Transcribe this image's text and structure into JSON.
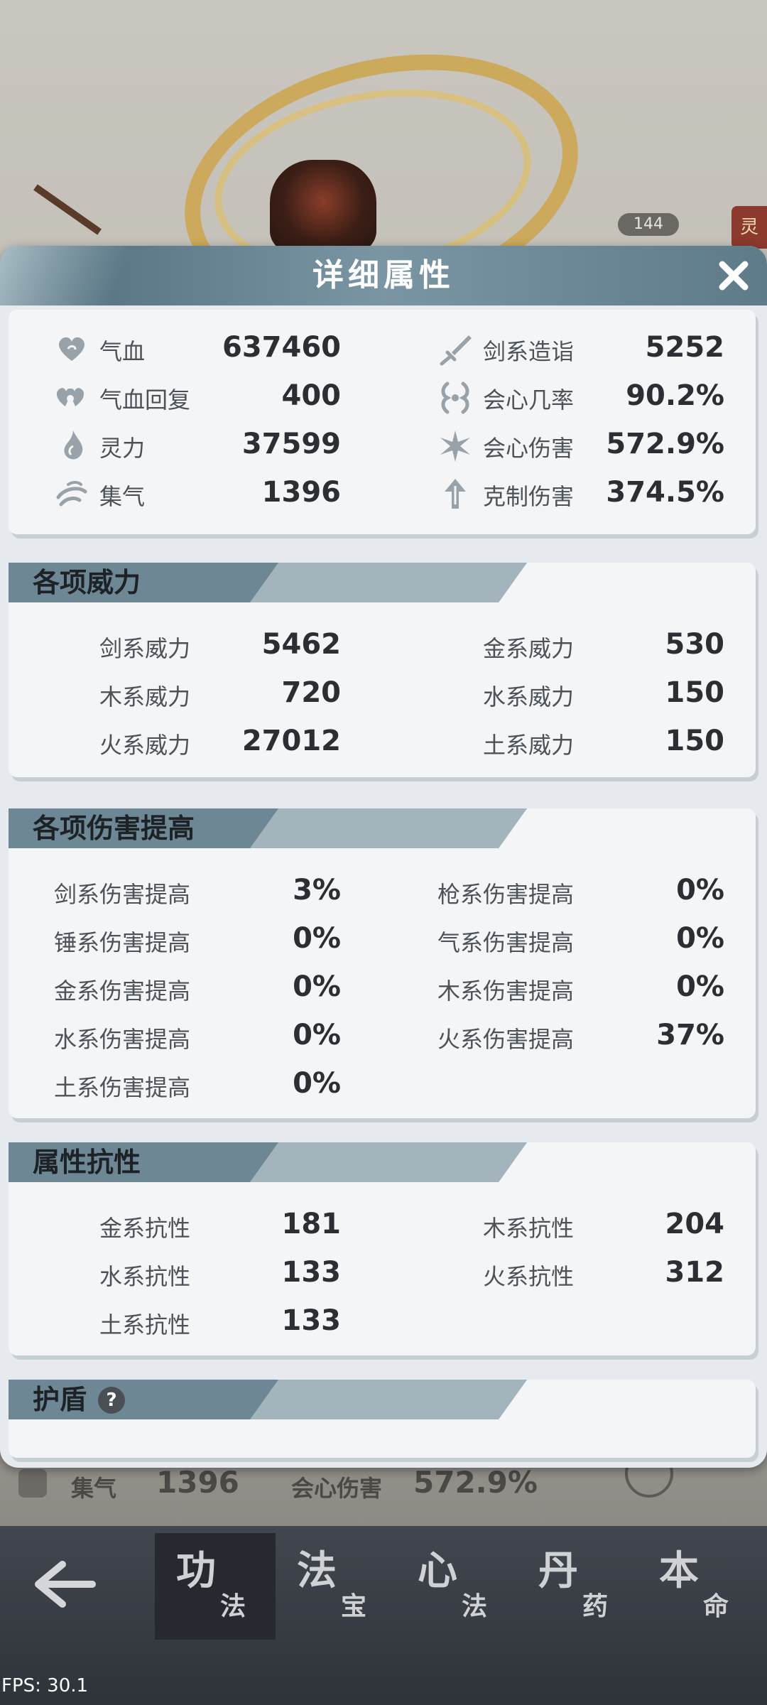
{
  "background": {
    "level_badge": "144",
    "side_tag": "灵",
    "under_row": {
      "stat_a_label": "集气",
      "stat_a_value": "1396",
      "stat_b_label": "会心伤害",
      "stat_b_value": "572.9%"
    }
  },
  "modal": {
    "title": "详细属性",
    "close_icon": "close-icon"
  },
  "basic_stats": {
    "left": [
      {
        "icon": "heart-icon",
        "label": "气血",
        "value": "637460"
      },
      {
        "icon": "double-heart-icon",
        "label": "气血回复",
        "value": "400"
      },
      {
        "icon": "flame-drop-icon",
        "label": "灵力",
        "value": "37599"
      },
      {
        "icon": "swirl-icon",
        "label": "集气",
        "value": "1396"
      }
    ],
    "right": [
      {
        "icon": "sword-icon",
        "label": "剑系造诣",
        "value": "5252"
      },
      {
        "icon": "crit-rate-icon",
        "label": "会心几率",
        "value": "90.2%"
      },
      {
        "icon": "starburst-icon",
        "label": "会心伤害",
        "value": "572.9%"
      },
      {
        "icon": "arrow-up-icon",
        "label": "克制伤害",
        "value": "374.5%"
      }
    ]
  },
  "power_section": {
    "title": "各项威力",
    "left": [
      {
        "label": "剑系威力",
        "value": "5462"
      },
      {
        "label": "木系威力",
        "value": "720"
      },
      {
        "label": "火系威力",
        "value": "27012"
      }
    ],
    "right": [
      {
        "label": "金系威力",
        "value": "530"
      },
      {
        "label": "水系威力",
        "value": "150"
      },
      {
        "label": "土系威力",
        "value": "150"
      }
    ]
  },
  "damage_section": {
    "title": "各项伤害提高",
    "left": [
      {
        "label": "剑系伤害提高",
        "value": "3%"
      },
      {
        "label": "锤系伤害提高",
        "value": "0%"
      },
      {
        "label": "金系伤害提高",
        "value": "0%"
      },
      {
        "label": "水系伤害提高",
        "value": "0%"
      },
      {
        "label": "土系伤害提高",
        "value": "0%"
      }
    ],
    "right": [
      {
        "label": "枪系伤害提高",
        "value": "0%"
      },
      {
        "label": "气系伤害提高",
        "value": "0%"
      },
      {
        "label": "木系伤害提高",
        "value": "0%"
      },
      {
        "label": "火系伤害提高",
        "value": "37%"
      }
    ]
  },
  "resist_section": {
    "title": "属性抗性",
    "left": [
      {
        "label": "金系抗性",
        "value": "181"
      },
      {
        "label": "水系抗性",
        "value": "133"
      },
      {
        "label": "土系抗性",
        "value": "133"
      }
    ],
    "right": [
      {
        "label": "木系抗性",
        "value": "204"
      },
      {
        "label": "火系抗性",
        "value": "312"
      }
    ]
  },
  "shield_section": {
    "title": "护盾",
    "help": "?"
  },
  "bottom_nav": {
    "back_icon": "back-arrow-icon",
    "tabs": [
      {
        "big": "功",
        "small": "法",
        "active": true
      },
      {
        "big": "法",
        "small": "宝",
        "active": false
      },
      {
        "big": "心",
        "small": "法",
        "active": false
      },
      {
        "big": "丹",
        "small": "药",
        "active": false
      },
      {
        "big": "本",
        "small": "命",
        "active": false
      }
    ]
  },
  "fps": "FPS: 30.1"
}
